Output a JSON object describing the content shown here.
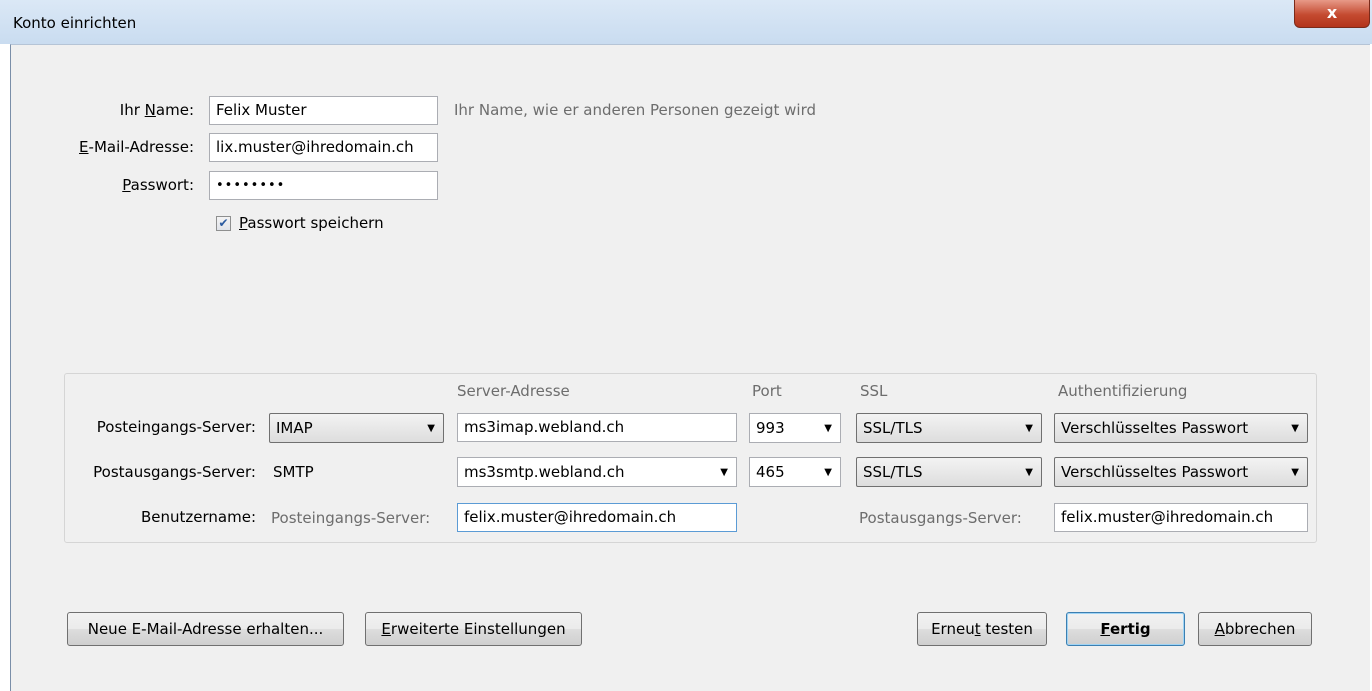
{
  "window": {
    "title": "Konto einrichten",
    "close_label": "x"
  },
  "form": {
    "name_label_pre": "Ihr ",
    "name_label_key": "N",
    "name_label_post": "ame:",
    "name_value": "Felix Muster",
    "name_hint": "Ihr Name, wie er anderen Personen gezeigt wird",
    "email_label_key": "E",
    "email_label_post": "-Mail-Adresse:",
    "email_value": "lix.muster@ihredomain.ch",
    "password_label_key": "P",
    "password_label_post": "asswort:",
    "password_mask": "••••••••",
    "save_password_key": "P",
    "save_password_post": "asswort speichern",
    "save_password_checked": true
  },
  "server": {
    "headers": {
      "address": "Server-Adresse",
      "port": "Port",
      "ssl": "SSL",
      "auth": "Authentifizierung"
    },
    "incoming": {
      "label": "Posteingangs-Server:",
      "protocol": "IMAP",
      "address": "ms3imap.webland.ch",
      "port": "993",
      "ssl": "SSL/TLS",
      "auth": "Verschlüsseltes Passwort"
    },
    "outgoing": {
      "label": "Postausgangs-Server:",
      "protocol": "SMTP",
      "address": "ms3smtp.webland.ch",
      "port": "465",
      "ssl": "SSL/TLS",
      "auth": "Verschlüsseltes Passwort"
    },
    "username": {
      "label": "Benutzername:",
      "incoming_label": "Posteingangs-Server:",
      "incoming_value": "felix.muster@ihredomain.ch",
      "outgoing_label": "Postausgangs-Server:",
      "outgoing_value": "felix.muster@ihredomain.ch"
    }
  },
  "buttons": {
    "new_email": "Neue E-Mail-Adresse erhalten...",
    "advanced_key": "E",
    "advanced_post": "rweiterte Einstellungen",
    "retest_pre": "Erneu",
    "retest_key": "t",
    "retest_post": " testen",
    "done_key": "F",
    "done_post": "ertig",
    "cancel_key": "A",
    "cancel_post": "bbrechen"
  }
}
